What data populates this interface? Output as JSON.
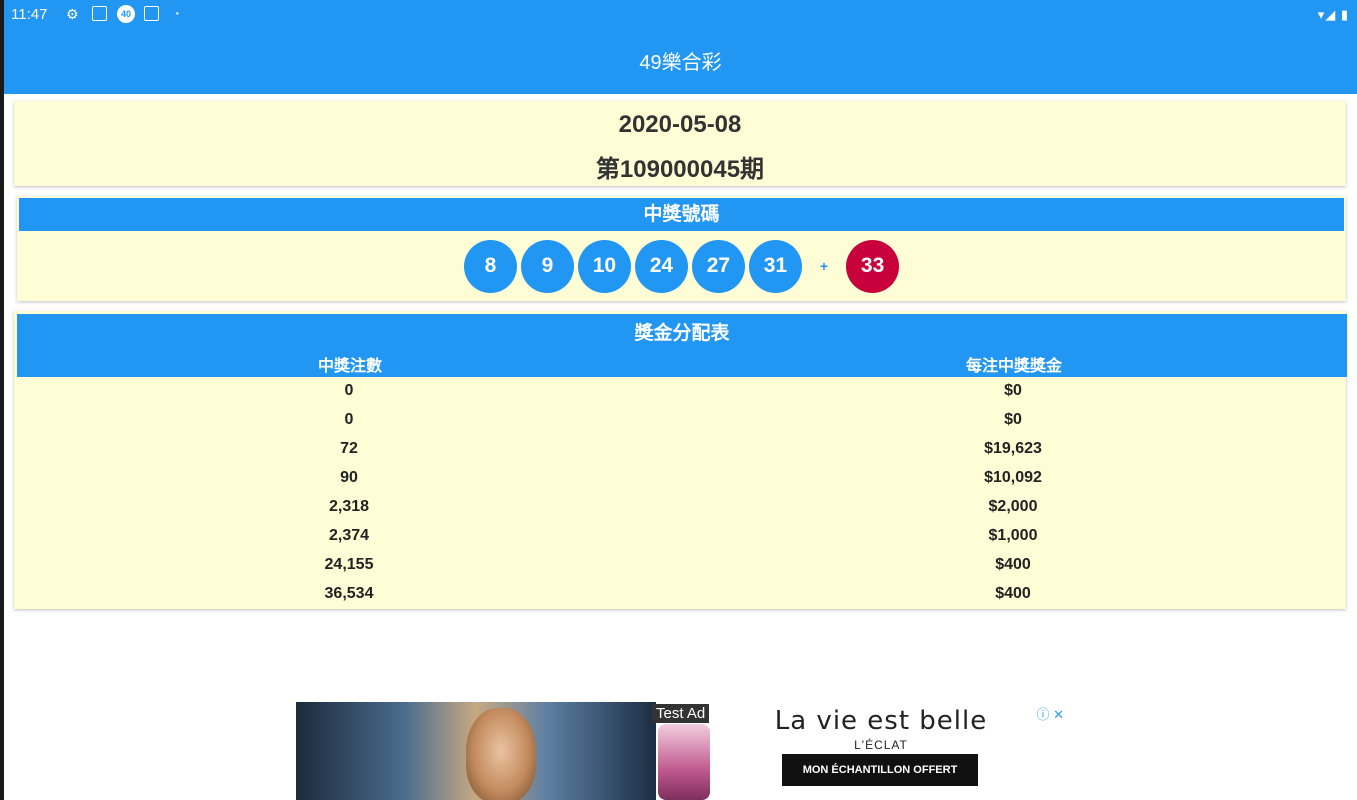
{
  "status_bar": {
    "time": "11:47",
    "icons": [
      "gear-icon",
      "box-icon",
      "badge-40-icon",
      "box-icon",
      "dot"
    ],
    "right_icons": [
      "wifi-icon",
      "signal-icon",
      "battery-icon"
    ]
  },
  "app_bar": {
    "title": "49樂合彩"
  },
  "draw": {
    "date": "2020-05-08",
    "period": "第109000045期"
  },
  "winning": {
    "title": "中獎號碼",
    "numbers": [
      "8",
      "9",
      "10",
      "24",
      "27",
      "31"
    ],
    "plus": "+",
    "special": "33"
  },
  "prize_table": {
    "title": "獎金分配表",
    "col_winners": "中獎注數",
    "col_prize": "每注中獎獎金",
    "rows": [
      {
        "winners": "0",
        "prize": "$0"
      },
      {
        "winners": "0",
        "prize": "$0"
      },
      {
        "winners": "72",
        "prize": "$19,623"
      },
      {
        "winners": "90",
        "prize": "$10,092"
      },
      {
        "winners": "2,318",
        "prize": "$2,000"
      },
      {
        "winners": "2,374",
        "prize": "$1,000"
      },
      {
        "winners": "24,155",
        "prize": "$400"
      },
      {
        "winners": "36,534",
        "prize": "$400"
      }
    ]
  },
  "ad": {
    "label": "Test Ad",
    "brand": "La vie est belle",
    "sub": "L'ÉCLAT",
    "cta": "MON ÉCHANTILLON OFFERT",
    "close": "ⓘ ✕"
  }
}
